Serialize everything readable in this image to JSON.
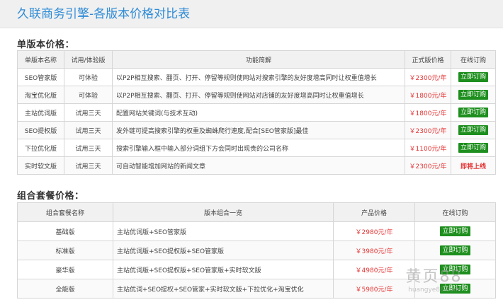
{
  "page": {
    "title": "久联商务引擎-各版本价格对比表"
  },
  "single": {
    "title": "单版本价格：",
    "headers": [
      "单版本名称",
      "试用/体验版",
      "功能简解",
      "正式版价格",
      "在线订购"
    ],
    "rows": [
      {
        "name": "SEO管家版",
        "trial": "可体验",
        "desc": "以P2P相互搜索、翻页、打开、停留等规则使网站对搜索引擎的友好度增高同时让权重值增长",
        "price": "￥2300元/年",
        "action": "立即订购"
      },
      {
        "name": "淘宝优化版",
        "trial": "可体验",
        "desc": "以P2P相互搜索、翻页、打开、停留等规则使网站对店铺的友好度增高同时让权重值增长",
        "price": "￥1800元/年",
        "action": "立即订购"
      },
      {
        "name": "主站优词版",
        "trial": "试用三天",
        "desc": "配置网站关键词(与技术互动)",
        "price": "￥1800元/年",
        "action": "立即订购"
      },
      {
        "name": "SEO提权版",
        "trial": "试用三天",
        "desc": "发外链可提高搜索引擎的权重及蜘蛛爬行速度,配合[SEO管家版]最佳",
        "price": "￥2300元/年",
        "action": "立即订购"
      },
      {
        "name": "下拉优化版",
        "trial": "试用三天",
        "desc": "搜索引擎输入框中输入部分词组下方会同时出现贵的公司名称",
        "price": "￥1100元/年",
        "action": "立即订购"
      },
      {
        "name": "实时软文版",
        "trial": "试用三天",
        "desc": "可自动智能增加网站的新闻文章",
        "price": "￥2300元/年",
        "action": "即将上线"
      }
    ]
  },
  "combo": {
    "title": "组合套餐价格：",
    "headers": [
      "组合套餐名称",
      "版本组合一览",
      "产品价格",
      "在线订购"
    ],
    "rows": [
      {
        "name": "基础版",
        "combo": "主站优词版+SEO管家版",
        "price": "￥2980元/年",
        "action": "立即订购"
      },
      {
        "name": "标准版",
        "combo": "主站优词版+SEO提权版+SEO管家版",
        "price": "￥3980元/年",
        "action": "立即订购"
      },
      {
        "name": "豪华版",
        "combo": "主站优词版+SEO提权版+SEO管家版+实时软文版",
        "price": "￥4980元/年",
        "action": "立即订购"
      },
      {
        "name": "全能版",
        "combo": "主站优词+SEO提权+SEO管家+实时软文版+下拉优化+淘宝优化",
        "price": "￥5980元/年",
        "action": "立即订购"
      }
    ]
  },
  "watermark": {
    "main": "黄页88",
    "sub": "huangye88.com"
  },
  "colors": {
    "title_blue": "#2e8bd6",
    "price_red": "#e53333",
    "order_green": "#1e8f1e",
    "header_bg": "#f1f1f1"
  }
}
